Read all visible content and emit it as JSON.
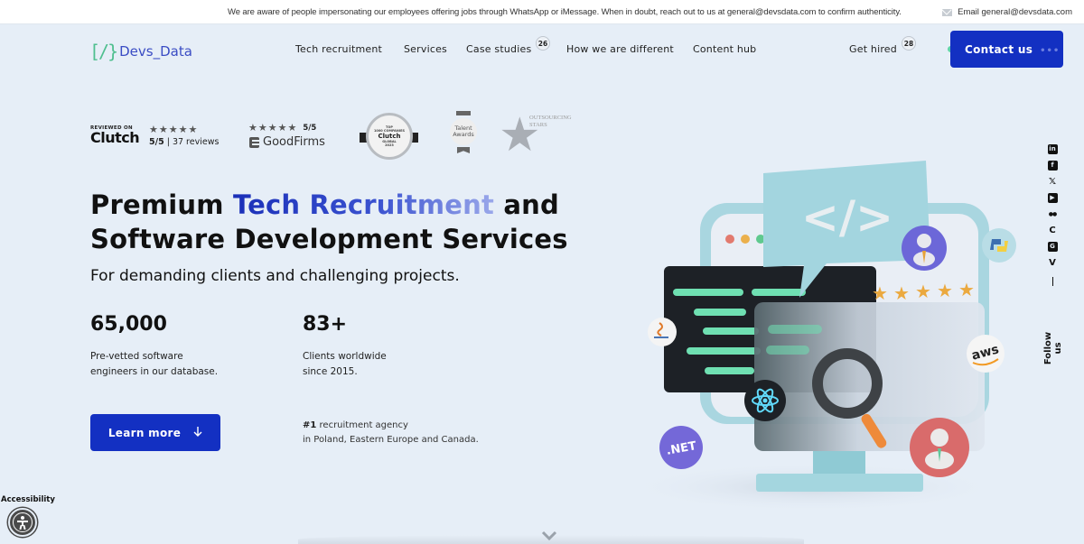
{
  "announcement": {
    "text": "We are aware of people impersonating our employees offering jobs through WhatsApp or iMessage. When in doubt, reach out to us at general@devsdata.com to confirm authenticity.",
    "email_label": "Email general@devsdata.com",
    "email_icon": "mail-icon"
  },
  "nav": {
    "logo_mark": "[/}",
    "logo_text": "Devs_Data",
    "links": [
      {
        "label": "Tech recruitment"
      },
      {
        "label": "Services"
      },
      {
        "label": "Case studies",
        "badge": "26"
      },
      {
        "label": "How we are different"
      },
      {
        "label": "Content hub"
      },
      {
        "label": "Get hired",
        "badge": "28"
      }
    ],
    "contact_label": "Contact us",
    "contact_dots": "•••",
    "colors": {
      "primary": "#1330c2",
      "logo_green": "#4fbf8f",
      "logo_blue": "#3a4cc4",
      "accent_dot": "#5fd3a8"
    }
  },
  "ratings": {
    "clutch": {
      "reviewed_on": "REVIEWED ON",
      "brand": "Clutch",
      "stars": "★★★★★",
      "score": "5/5",
      "reviews": "37 reviews"
    },
    "goodfirms": {
      "stars": "★★★★★",
      "score": "5/5",
      "brand": "GoodFirms"
    },
    "awards": [
      {
        "name": "Clutch Top 1000 Companies Global 2023",
        "line1": "TOP",
        "line2": "1000 COMPANIES",
        "brand": "Clutch",
        "line3": "GLOBAL",
        "line4": "2023"
      },
      {
        "name": "Talent Awards Winner",
        "line1": "Talent",
        "line2": "Awards"
      },
      {
        "name": "Outsourcing Stars",
        "line1": "OUTSOURCING",
        "line2": "STARS"
      }
    ]
  },
  "hero": {
    "headline_pre": "Premium ",
    "headline_highlight": "Tech Recruitment",
    "headline_mid": " and",
    "headline_bold": "Software Development",
    "headline_post": " Services",
    "subheadline": "For demanding clients and challenging projects.",
    "stats": [
      {
        "value": "65,000",
        "line1": "Pre-vetted software",
        "line2": "engineers in our database."
      },
      {
        "value": "83+",
        "line1": "Clients worldwide",
        "line2": "since 2015."
      }
    ],
    "cta_label": "Learn more",
    "cta_icon": "arrow-down-icon",
    "agency_rank": "#1",
    "agency_line1": " recruitment agency",
    "agency_line2": "in Poland, Eastern Europe and Canada."
  },
  "illustration": {
    "code_symbol": "</>",
    "badges": [
      "Java",
      "React",
      ".NET",
      "Python",
      "AWS"
    ],
    "aws_label": "aws",
    "net_label": ".NET"
  },
  "social": {
    "icons": [
      "linkedin-icon",
      "facebook-icon",
      "x-icon",
      "youtube-icon",
      "medium-icon",
      "clutch-icon",
      "goodfirms-icon",
      "vimeo-icon"
    ],
    "glyphs": [
      "in",
      "f",
      "𝕏",
      "▶",
      "●●",
      "C",
      "G",
      "V"
    ],
    "follow_label": "Follow us"
  },
  "accessibility": {
    "label": "Accessibility"
  }
}
